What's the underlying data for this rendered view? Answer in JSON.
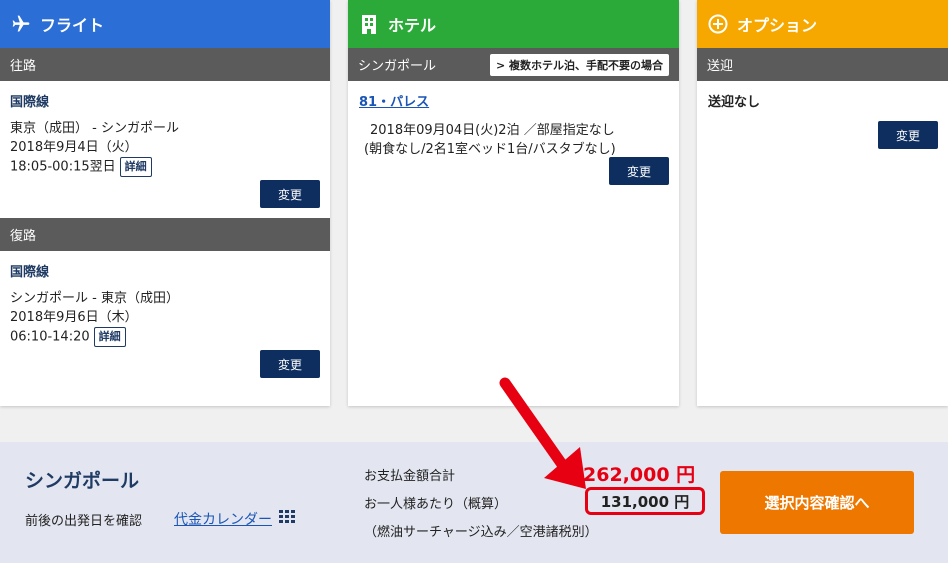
{
  "colors": {
    "flight_header": "#2b6fd6",
    "hotel_header": "#2baa3a",
    "option_header": "#f7a800",
    "button_navy": "#0d2e5e",
    "confirm_orange": "#ee7700",
    "price_red": "#e60012"
  },
  "flight": {
    "title": "フライト",
    "icon": "airplane-icon",
    "outbound": {
      "label": "往路",
      "type": "国際線",
      "route": "東京（成田） - シンガポール",
      "date": "2018年9月4日（火）",
      "time": "18:05-00:15翌日",
      "detail": "詳細",
      "change": "変更"
    },
    "return": {
      "label": "復路",
      "type": "国際線",
      "route": "シンガポール - 東京（成田）",
      "date": "2018年9月6日（木）",
      "time": "06:10-14:20",
      "detail": "詳細",
      "change": "変更"
    }
  },
  "hotel": {
    "title": "ホテル",
    "icon": "building-icon",
    "city": "シンガポール",
    "multi_note": "> 複数ホテル泊、手配不要の場合",
    "name": "81・パレス",
    "line1": "2018年09月04日(火)2泊 ／部屋指定なし",
    "line2": "(朝食なし/2名1室ベッド1台/バスタブなし)",
    "change": "変更"
  },
  "option": {
    "title": "オプション",
    "icon": "plus-circle-icon",
    "bar": "送迎",
    "value": "送迎なし",
    "change": "変更"
  },
  "summary": {
    "destination": "シンガポール",
    "nearby_label": "前後の出発日を確認",
    "calendar_link": "代金カレンダー",
    "total_label": "お支払金額合計",
    "total": "262,000 円",
    "per_person_label": "お一人様あたり（概算）",
    "per_person": "131,000 円",
    "note": "（燃油サーチャージ込み／空港諸税別）",
    "confirm": "選択内容確認へ"
  }
}
